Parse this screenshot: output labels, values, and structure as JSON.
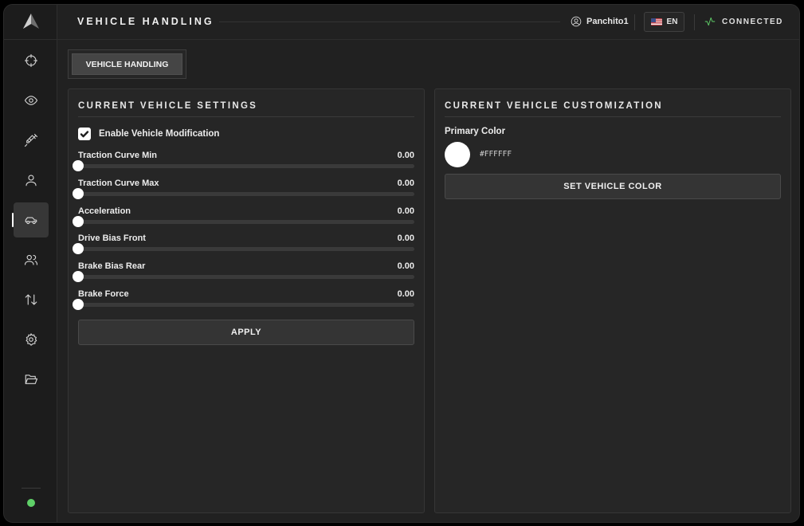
{
  "header": {
    "title": "VEHICLE HANDLING",
    "username": "Panchito1",
    "language": "EN",
    "connection_status": "CONNECTED"
  },
  "sidebar": {
    "items": [
      {
        "icon": "crosshair-icon",
        "active": false
      },
      {
        "icon": "eye-icon",
        "active": false
      },
      {
        "icon": "syringe-icon",
        "active": false
      },
      {
        "icon": "user-icon",
        "active": false
      },
      {
        "icon": "car-icon",
        "active": true
      },
      {
        "icon": "users-icon",
        "active": false
      },
      {
        "icon": "transfer-arrows-icon",
        "active": false
      },
      {
        "icon": "gear-icon",
        "active": false
      },
      {
        "icon": "folder-open-icon",
        "active": false
      }
    ],
    "status_color": "#5fd068"
  },
  "tabs": [
    {
      "label": "VEHICLE HANDLING",
      "active": true
    }
  ],
  "settings": {
    "title": "CURRENT VEHICLE SETTINGS",
    "enable_label": "Enable Vehicle Modification",
    "enable_checked": true,
    "sliders": [
      {
        "label": "Traction Curve Min",
        "value": "0.00",
        "fraction": 0
      },
      {
        "label": "Traction Curve Max",
        "value": "0.00",
        "fraction": 0
      },
      {
        "label": "Acceleration",
        "value": "0.00",
        "fraction": 0
      },
      {
        "label": "Drive Bias Front",
        "value": "0.00",
        "fraction": 0
      },
      {
        "label": "Brake Bias Rear",
        "value": "0.00",
        "fraction": 0
      },
      {
        "label": "Brake Force",
        "value": "0.00",
        "fraction": 0
      }
    ],
    "apply_label": "APPLY"
  },
  "customization": {
    "title": "CURRENT VEHICLE CUSTOMIZATION",
    "primary_color_label": "Primary Color",
    "primary_color_hex": "#FFFFFF",
    "set_color_label": "SET VEHICLE COLOR"
  },
  "colors": {
    "background": "#212121",
    "panel": "#262626",
    "connected_accent": "#5fd068"
  }
}
